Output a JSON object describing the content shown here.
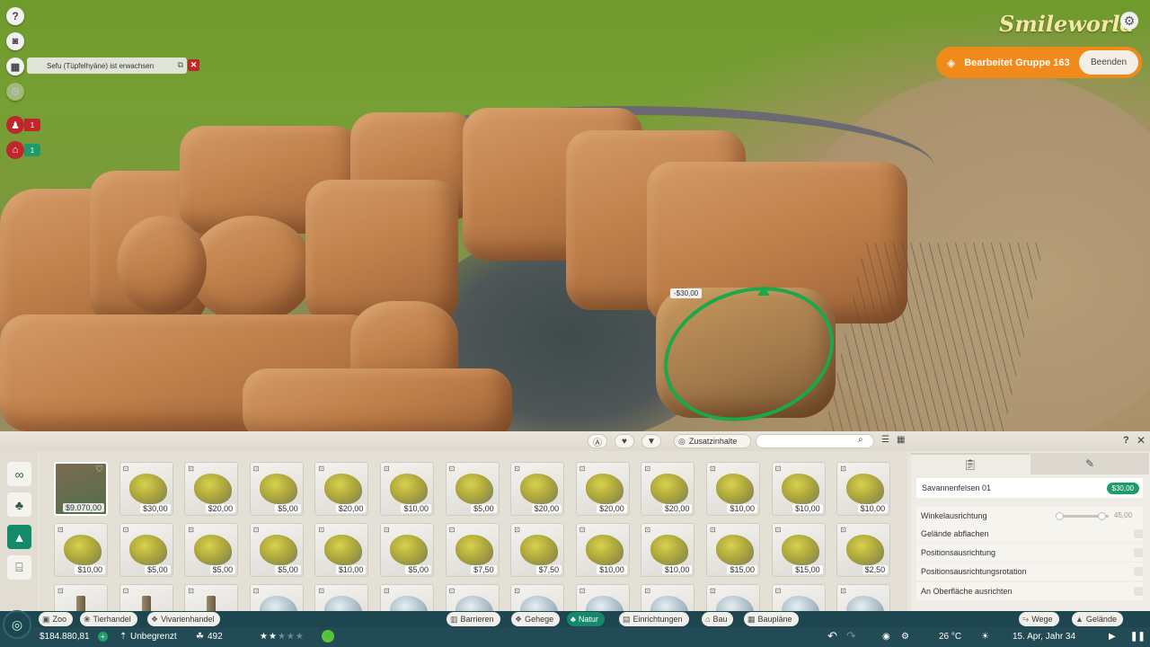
{
  "hud": {
    "help_label": "?",
    "notification_text": "Sefu (Tüpfelhyäne) ist erwachsen",
    "notification_close": "✕",
    "alert_guests_count": "1",
    "alert_shop_count": "1"
  },
  "viewport": {
    "cost_tag": "-$30,00"
  },
  "top_right": {
    "logo": "Smileworld",
    "group_label": "Bearbeitet Gruppe 163",
    "end_button": "Beenden"
  },
  "panel": {
    "dlc_label": "Zusatzinhalte",
    "search_value": "",
    "help": "?",
    "close": "✕",
    "featured_price": "$9.070,00",
    "rows": [
      [
        "$30,00",
        "$20,00",
        "$5,00",
        "$20,00",
        "$10,00",
        "$5,00",
        "$20,00",
        "$20,00",
        "$20,00",
        "$10,00",
        "$10,00",
        "$10,00"
      ],
      [
        "$10,00",
        "$5,00",
        "$5,00",
        "$5,00",
        "$10,00",
        "$5,00",
        "$7,50",
        "$7,50",
        "$10,00",
        "$10,00",
        "$15,00",
        "$15,00",
        "$2,50"
      ]
    ]
  },
  "info": {
    "item_name": "Savannenfelsen 01",
    "item_price": "$30,00",
    "options": {
      "angle_label": "Winkelausrichtung",
      "angle_value": "45,00",
      "angle_level": 0.85,
      "flatten": "Gelände abflachen",
      "pos_align": "Positionsausrichtung",
      "pos_rot": "Positionsausrichtungsrotation",
      "surface": "An Oberfläche ausrichten"
    }
  },
  "nav": {
    "zoo": "Zoo",
    "tierhandel": "Tierhandel",
    "vivarien": "Vivarienhandel",
    "barrieren": "Barrieren",
    "gehege": "Gehege",
    "natur": "Natur",
    "einrichtungen": "Einrichtungen",
    "bau": "Bau",
    "bauplaene": "Baupläne",
    "wege": "Wege",
    "gelaende": "Gelände"
  },
  "status": {
    "money": "$184.880,81",
    "budget": "Unbegrenzt",
    "guests": "492",
    "rating_stars": 2,
    "temperature": "26 °C",
    "date": "15. Apr, Jahr 34"
  },
  "colors": {
    "accent_green": "#138a6a",
    "orange": "#f08b1b",
    "alert_red": "#c0272d"
  }
}
